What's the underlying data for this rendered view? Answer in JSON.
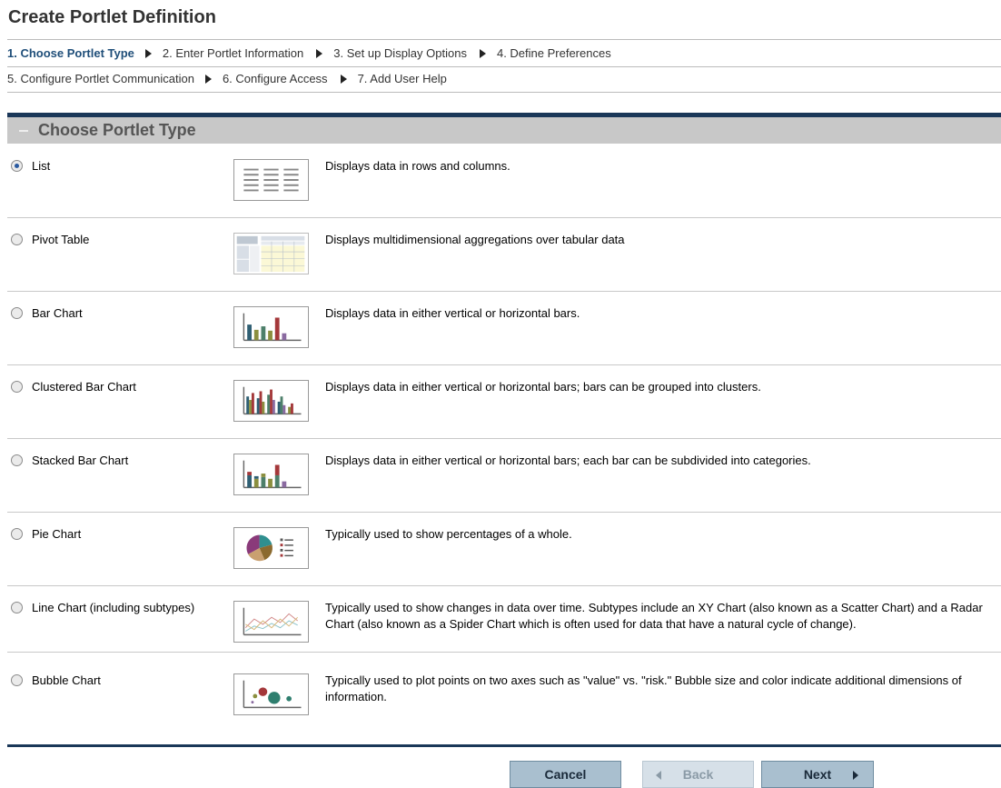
{
  "title": "Create Portlet Definition",
  "steps_row1": [
    {
      "label": "1. Choose Portlet Type",
      "active": true
    },
    {
      "label": "2. Enter Portlet Information",
      "active": false
    },
    {
      "label": "3. Set up Display Options",
      "active": false
    },
    {
      "label": "4. Define Preferences",
      "active": false
    }
  ],
  "steps_row2": [
    {
      "label": "5. Configure Portlet Communication",
      "active": false
    },
    {
      "label": "6. Configure Access",
      "active": false
    },
    {
      "label": "7. Add User Help",
      "active": false
    }
  ],
  "section_title": "Choose Portlet Type",
  "options": [
    {
      "label": "List",
      "description": "Displays data in rows and columns.",
      "checked": true,
      "icon": "list-icon"
    },
    {
      "label": "Pivot Table",
      "description": "Displays multidimensional aggregations over tabular data",
      "checked": false,
      "icon": "pivot-table-icon"
    },
    {
      "label": "Bar Chart",
      "description": "Displays data in either vertical or horizontal bars.",
      "checked": false,
      "icon": "bar-chart-icon"
    },
    {
      "label": "Clustered Bar Chart",
      "description": "Displays data in either vertical or horizontal bars; bars can be grouped into clusters.",
      "checked": false,
      "icon": "clustered-bar-chart-icon"
    },
    {
      "label": "Stacked Bar Chart",
      "description": "Displays data in either vertical or horizontal bars; each bar can be subdivided into categories.",
      "checked": false,
      "icon": "stacked-bar-chart-icon"
    },
    {
      "label": "Pie Chart",
      "description": "Typically used to show percentages of a whole.",
      "checked": false,
      "icon": "pie-chart-icon"
    },
    {
      "label": "Line Chart (including subtypes)",
      "description": "Typically used to show changes in data over time. Subtypes include an XY Chart (also known as a Scatter Chart) and a Radar Chart (also known as a Spider Chart which is often used for data that have a natural cycle of change).",
      "checked": false,
      "icon": "line-chart-icon"
    },
    {
      "label": "Bubble Chart",
      "description": "Typically used to plot points on two axes such as \"value\" vs. \"risk.\" Bubble size and color indicate additional dimensions of information.",
      "checked": false,
      "icon": "bubble-chart-icon"
    }
  ],
  "buttons": {
    "cancel": "Cancel",
    "back": "Back",
    "next": "Next"
  }
}
